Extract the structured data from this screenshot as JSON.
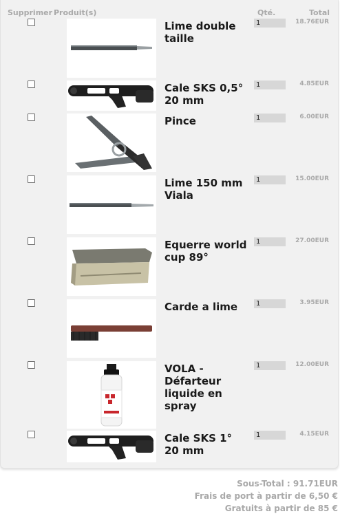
{
  "header": {
    "supprimer": "Supprimer",
    "produit": "Produit(s)",
    "qte": "Qté.",
    "total": "Total"
  },
  "items": [
    {
      "name": "Lime double taille",
      "qty": "1",
      "price": "18.76EUR",
      "icon": "file-tool"
    },
    {
      "name": "Cale SKS 0,5° 20 mm",
      "qty": "1",
      "price": "4.85EUR",
      "icon": "edge-guide"
    },
    {
      "name": "Pince",
      "qty": "1",
      "price": "6.00EUR",
      "icon": "spring-clamp"
    },
    {
      "name": "Lime 150 mm Viala",
      "qty": "1",
      "price": "15.00EUR",
      "icon": "file-tool"
    },
    {
      "name": "Equerre world cup 89°",
      "qty": "1",
      "price": "27.00EUR",
      "icon": "angle-guide"
    },
    {
      "name": "Carde a lime",
      "qty": "1",
      "price": "3.95EUR",
      "icon": "file-brush"
    },
    {
      "name": "VOLA - Défarteur liquide en spray",
      "qty": "1",
      "price": "12.00EUR",
      "icon": "spray-bottle"
    },
    {
      "name": "Cale SKS 1° 20 mm",
      "qty": "1",
      "price": "4.15EUR",
      "icon": "edge-guide"
    }
  ],
  "summary": {
    "subtotal": "Sous-Total : 91.71EUR",
    "shipping": "Frais de port à partir de 6,50 €",
    "free": "Gratuits à partir de 85 €"
  }
}
